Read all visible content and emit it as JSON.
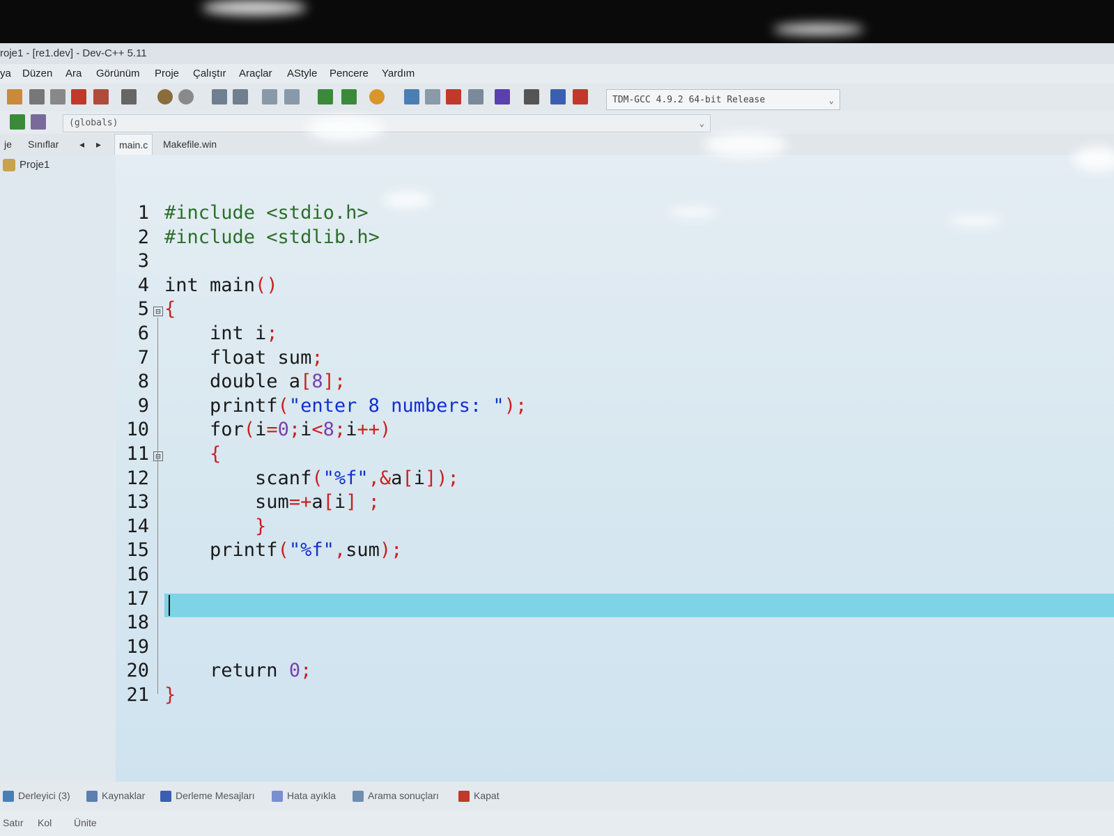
{
  "window": {
    "title": "roje1 - [re1.dev] - Dev-C++ 5.11"
  },
  "menu": [
    "ya",
    "Düzen",
    "Ara",
    "Görünüm",
    "Proje",
    "Çalıştır",
    "Araçlar",
    "AStyle",
    "Pencere",
    "Yardım"
  ],
  "toolbar": {
    "compiler": "TDM-GCC 4.9.2 64-bit Release"
  },
  "scope": {
    "value": "(globals)"
  },
  "sidebar_tabs": [
    "je",
    "Sınıflar"
  ],
  "editor_tabs": [
    "main.c",
    "Makefile.win"
  ],
  "project_tree": {
    "item": "Proje1"
  },
  "code_lines": [
    "#include <stdio.h>",
    "#include <stdlib.h>",
    "",
    "int main()",
    "{",
    "    int i;",
    "    float sum;",
    "    double a[8];",
    "    printf(\"enter 8 numbers: \");",
    "    for(i=0;i<8;i++)",
    "    {",
    "        scanf(\"%f\",&a[i]);",
    "        sum=+a[i] ;",
    "        }",
    "    printf(\"%f\",sum);",
    "",
    "",
    "",
    "",
    "    return 0;",
    "}"
  ],
  "line_numbers": [
    "1",
    "2",
    "3",
    "4",
    "5",
    "6",
    "7",
    "8",
    "9",
    "10",
    "11",
    "12",
    "13",
    "14",
    "15",
    "16",
    "17",
    "18",
    "19",
    "20",
    "21"
  ],
  "bottom_tabs": [
    "Derleyici (3)",
    "Kaynaklar",
    "Derleme Mesajları",
    "Hata ayıkla",
    "Arama sonuçları",
    "Kapat"
  ],
  "status": [
    "Satır",
    "Kol",
    "Ünite"
  ]
}
